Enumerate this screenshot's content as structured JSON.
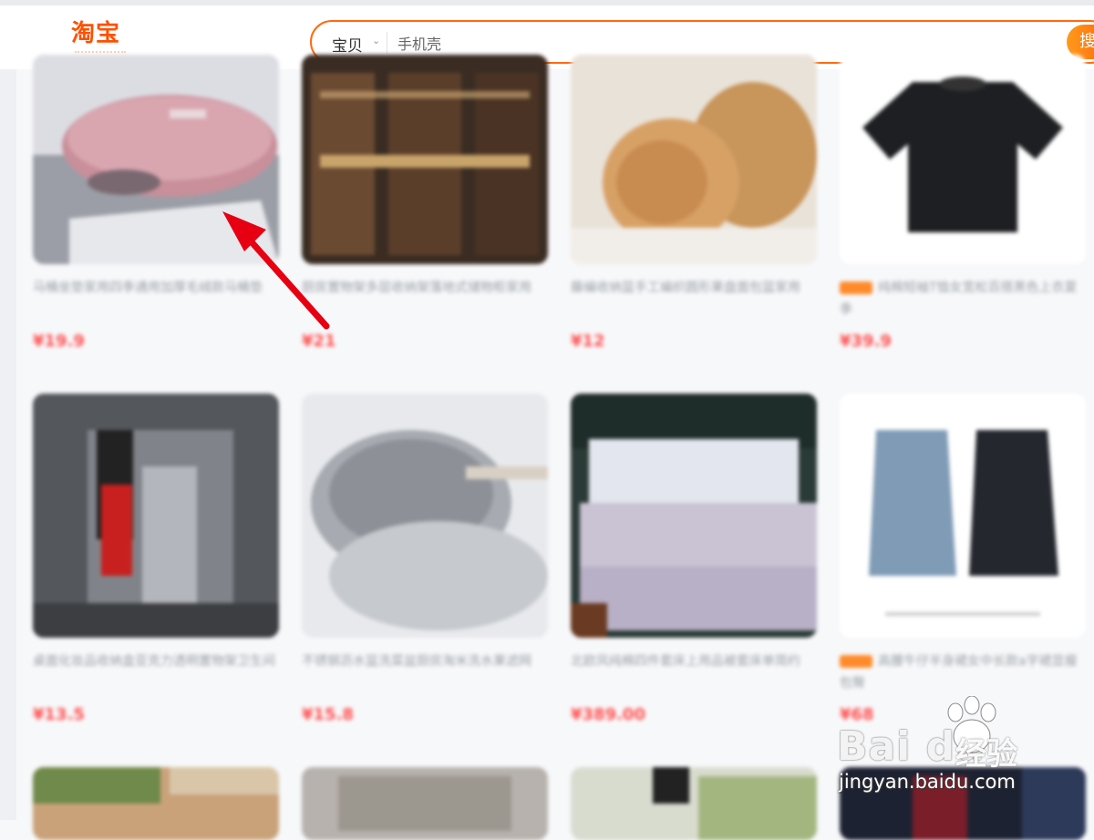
{
  "header": {
    "logo_text": "淘宝",
    "search_category": "宝贝",
    "search_placeholder": "手机壳",
    "search_button_label": "搜"
  },
  "products": [
    {
      "title": "马桶坐垫家用四季通用加厚毛绒款马桶垫",
      "price": "¥19.9",
      "image": "pink-toilet-seat-cover"
    },
    {
      "title": "厨房置物架多层收纳架落地式储物柜家用",
      "price": "¥21",
      "image": "kitchen-cabinet"
    },
    {
      "title": "藤编收纳篮手工编织圆形果盘面包篮家用",
      "price": "¥12",
      "image": "rattan-baskets"
    },
    {
      "title": "纯棉短袖T恤女宽松百搭黑色上衣夏季",
      "price": "¥39.9",
      "image": "black-tshirt"
    },
    {
      "title": "桌面化妆品收纳盒亚克力透明置物架卫生间",
      "price": "¥13.5",
      "image": "acrylic-organizer"
    },
    {
      "title": "不锈钢沥水篮洗菜盆厨房淘米洗水果滤网",
      "price": "¥15.8",
      "image": "steel-colander"
    },
    {
      "title": "北欧风纯棉四件套床上用品被套床单简约",
      "price": "¥389.00",
      "image": "bedding-set"
    },
    {
      "title": "高腰牛仔半身裙女中长款a字裙显瘦包臀",
      "price": "¥68",
      "image": "denim-skirts"
    },
    {
      "title": "",
      "price": "",
      "image": "bottom-row-1"
    },
    {
      "title": "",
      "price": "",
      "image": "bottom-row-2"
    },
    {
      "title": "",
      "price": "",
      "image": "bottom-row-3"
    },
    {
      "title": "",
      "price": "",
      "image": "bottom-row-4"
    }
  ],
  "watermark": {
    "logo": "Bai du",
    "cn": "经验",
    "url": "jingyan.baidu.com"
  }
}
